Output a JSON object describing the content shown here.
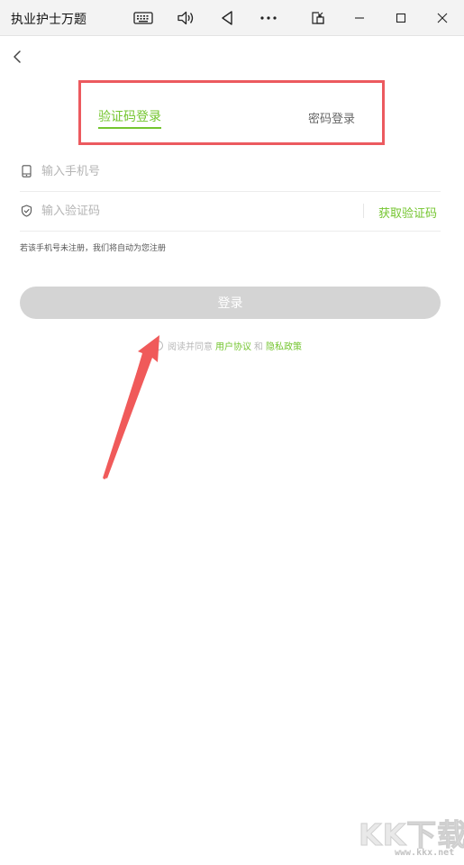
{
  "window": {
    "title": "执业护士万题",
    "controls": [
      "keyboard-icon",
      "volume-icon",
      "back-triangle-icon",
      "more-icon",
      "pip-icon",
      "minimize-icon",
      "maximize-icon",
      "close-icon"
    ]
  },
  "login": {
    "tabs": [
      {
        "label": "验证码登录",
        "active": true
      },
      {
        "label": "密码登录",
        "active": false
      }
    ],
    "phone_placeholder": "输入手机号",
    "code_placeholder": "输入验证码",
    "get_code_label": "获取验证码",
    "hint": "若该手机号未注册，我们将自动为您注册",
    "submit_label": "登录",
    "agreement": {
      "prefix": "阅读并同意",
      "user_agreement": "用户协议",
      "and": "和",
      "privacy_policy": "隐私政策",
      "checked": false
    }
  },
  "watermark": {
    "brand": "KK下载",
    "url": "www.kkx.net"
  },
  "colors": {
    "accent": "#74c52f",
    "highlight_box": "#ec5a5f",
    "button_disabled": "#d4d4d4"
  }
}
